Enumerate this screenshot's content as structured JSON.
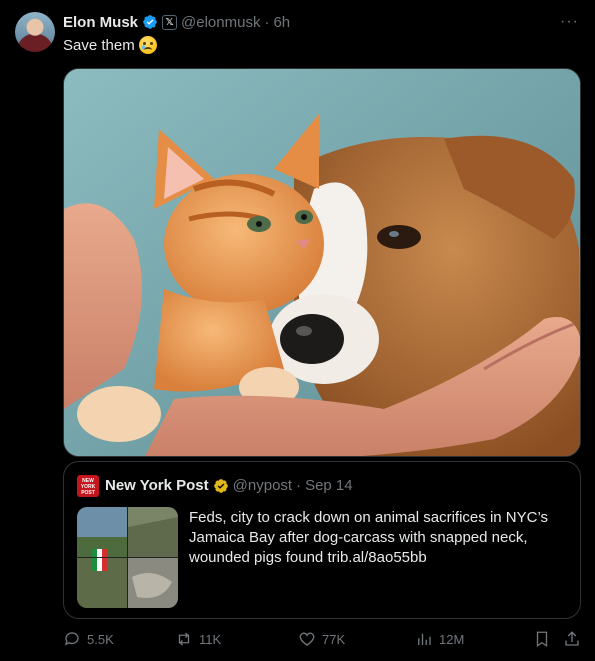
{
  "post": {
    "author_name": "Elon Musk",
    "handle": "@elonmusk",
    "separator": "·",
    "time": "6h",
    "more": "···",
    "text": "Save them",
    "emoji": "crying-face-emoji"
  },
  "quote": {
    "logo_text": "NEW YORK POST",
    "author_name": "New York Post",
    "handle": "@nypost",
    "separator": "·",
    "time": "Sep 14",
    "text": "Feds, city to crack down on animal sacrifices in NYC’s Jamaica Bay after dog-carcass with snapped neck, wounded pigs found trib.al/8ao55bb"
  },
  "actions": {
    "replies": "5.5K",
    "reposts": "11K",
    "likes": "77K",
    "views": "12M"
  },
  "icons": [
    "verified-icon",
    "x-badge-icon",
    "more-icon",
    "reply-icon",
    "repost-icon",
    "like-icon",
    "views-icon",
    "bookmark-icon",
    "share-icon"
  ],
  "colors": {
    "background": "#000000",
    "text": "#e7e9ea",
    "muted": "#71767b",
    "border": "#2f3336",
    "verified_blue": "#1d9bf0",
    "verified_gold": "#e2b719"
  }
}
